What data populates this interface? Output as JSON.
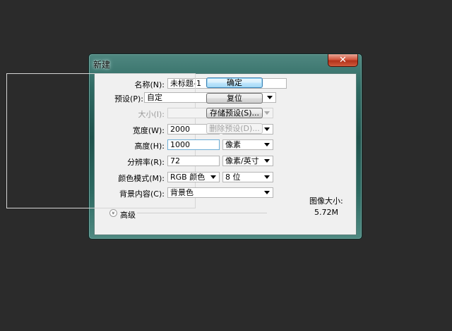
{
  "dialog": {
    "title": "新建",
    "close_glyph": "✕"
  },
  "form": {
    "name": {
      "label": "名称(N):",
      "value": "未标题-1"
    },
    "preset": {
      "label": "预设(P):",
      "value": "自定"
    },
    "size": {
      "label": "大小(I):",
      "value": ""
    },
    "width": {
      "label": "宽度(W):",
      "value": "2000",
      "unit": "像素"
    },
    "height": {
      "label": "高度(H):",
      "value": "1000",
      "unit": "像素"
    },
    "resolution": {
      "label": "分辨率(R):",
      "value": "72",
      "unit": "像素/英寸"
    },
    "color_mode": {
      "label": "颜色模式(M):",
      "value": "RGB 颜色",
      "depth": "8 位"
    },
    "background": {
      "label": "背景内容(C):",
      "value": "背景色"
    },
    "advanced": {
      "label": "高级",
      "icon": "double-chevron-down-icon",
      "glyph": "»"
    }
  },
  "buttons": {
    "ok": "确定",
    "reset": "复位",
    "save_preset": "存储预设(S)...",
    "delete_preset": "删除预设(D)..."
  },
  "image_size": {
    "label": "图像大小:",
    "value": "5.72M"
  },
  "colors": {
    "desktop": "#2b2b2b",
    "frame": "#2f6a63",
    "client": "#f0f0f0",
    "close": "#c8472c",
    "default_button": "#bee6fd"
  }
}
